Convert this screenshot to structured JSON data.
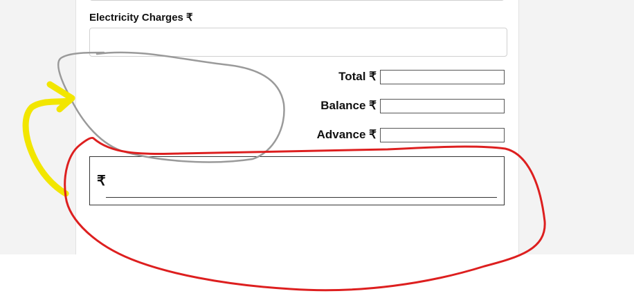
{
  "form": {
    "electricity_label": "Electricity Charges ₹",
    "electricity_value": "",
    "total_label": "Total ₹",
    "total_value": "",
    "balance_label": "Balance ₹",
    "balance_value": "",
    "advance_label": "Advance ₹",
    "advance_value": "",
    "amount_symbol": "₹"
  },
  "annotations": {
    "gray_circle_color": "#9a9a9a",
    "yellow_arrow_color": "#f2e600",
    "red_circle_color": "#dd1f1f"
  }
}
